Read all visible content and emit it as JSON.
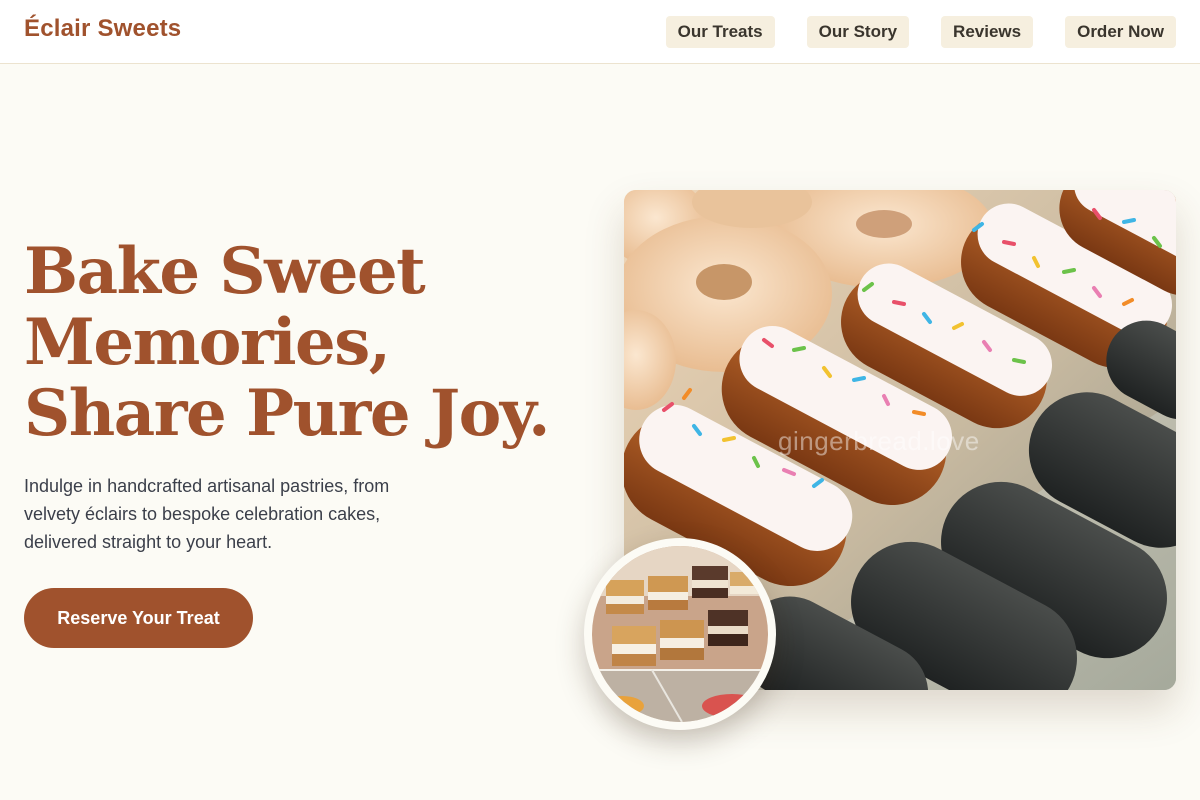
{
  "brand": {
    "name": "Éclair Sweets"
  },
  "nav": {
    "items": [
      {
        "label": "Our Treats"
      },
      {
        "label": "Our Story"
      },
      {
        "label": "Reviews"
      },
      {
        "label": "Order Now"
      }
    ]
  },
  "hero": {
    "headline_lines": [
      "Bake Sweet",
      "Memories,",
      "Share Pure Joy."
    ],
    "intro_lines": [
      "Indulge in handcrafted artisanal pastries, from",
      "velvety éclairs to bespoke celebration cakes,",
      "delivered straight to your heart."
    ],
    "cta_label": "Reserve Your Treat",
    "photo_watermark": "gingerbread.love"
  },
  "colors": {
    "accent": "#a0522d",
    "background": "#fcfbf5",
    "nav_pill": "#f6efdf"
  },
  "images": {
    "hero_photo": "tray of sprinkle-topped and chocolate-glazed éclairs with donuts",
    "inset_photo": "layered pastry slices in a display case"
  }
}
